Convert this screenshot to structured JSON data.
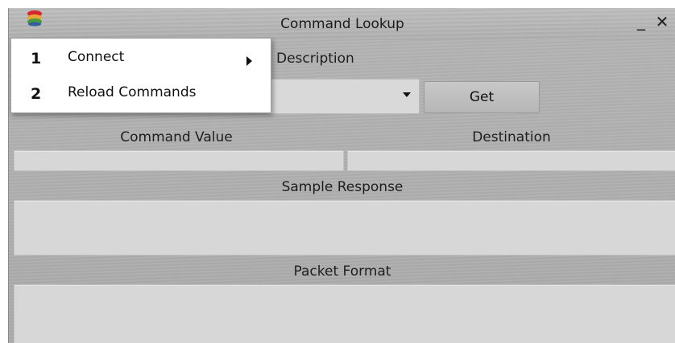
{
  "window": {
    "title": "Command Lookup",
    "minimize_symbol": "_",
    "close_symbol": "✕",
    "app_icon": "app-logo-icon"
  },
  "form": {
    "description_label": "Description",
    "description_value": "",
    "get_button": "Get",
    "command_value_label": "Command Value",
    "command_value": "",
    "destination_label": "Destination",
    "destination_value": "",
    "sample_response_label": "Sample Response",
    "sample_response_value": "",
    "packet_format_label": "Packet Format",
    "packet_format_value": ""
  },
  "context_menu": {
    "items": [
      {
        "number": "1",
        "label": "Connect",
        "has_submenu": true
      },
      {
        "number": "2",
        "label": "Reload Commands",
        "has_submenu": false
      }
    ]
  },
  "colors": {
    "window_bg": "#afafaf",
    "field_bg": "#d7d7d7",
    "menu_bg": "#ffffff"
  }
}
